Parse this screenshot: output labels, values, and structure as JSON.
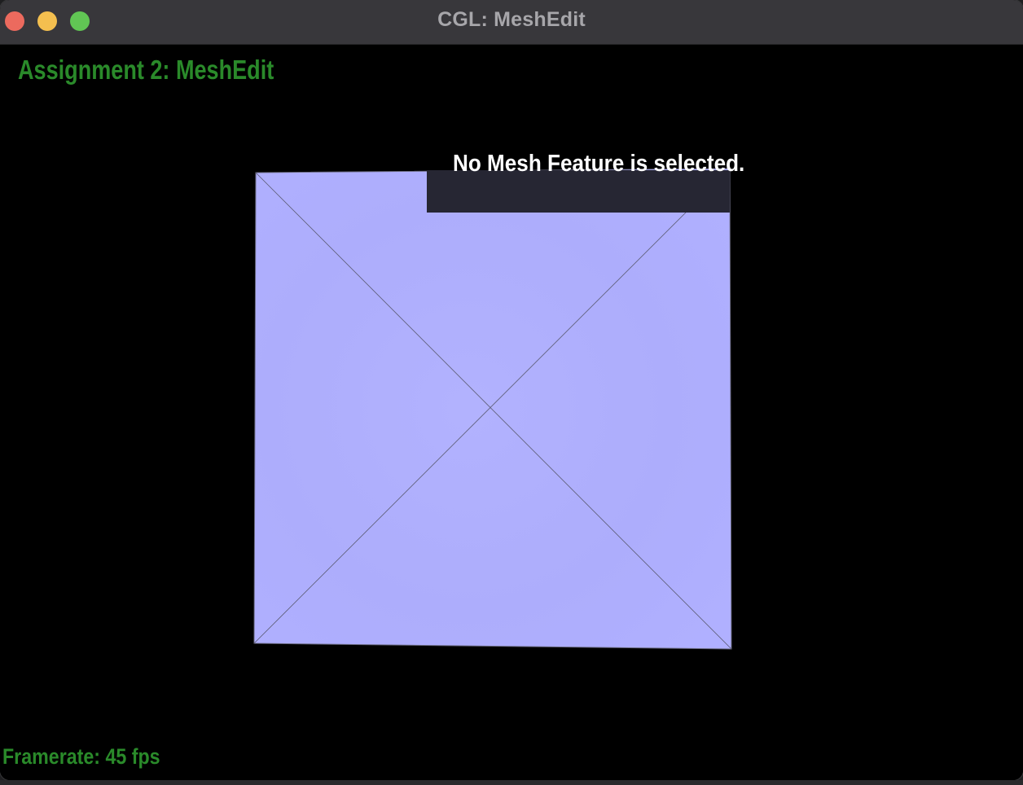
{
  "window": {
    "title": "CGL: MeshEdit",
    "controls": [
      "close",
      "minimize",
      "zoom"
    ]
  },
  "viewport": {
    "assignment_title": "Assignment 2: MeshEdit",
    "status_message": "No Mesh Feature is selected.",
    "framerate_label": "Framerate: 45 fps",
    "framerate_value": 45
  },
  "colors": {
    "overlay_text": "#2a8a2a",
    "mesh_face": "#b0b0ff",
    "mesh_edge": "#5a5a70",
    "background": "#000000",
    "status_box": "#262633",
    "status_text": "#ffffff"
  },
  "mesh": {
    "shape": "quad",
    "diagonals": 2,
    "selected_feature": "none"
  }
}
